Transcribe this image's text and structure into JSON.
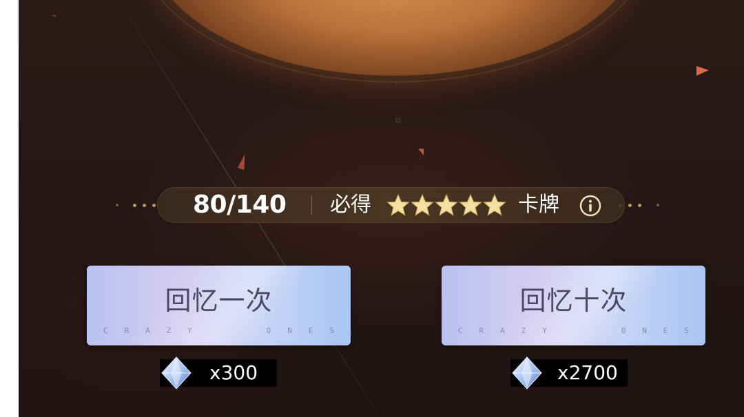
{
  "pity": {
    "count": "80/140",
    "guarantee_label": "必得",
    "star_rating": 5,
    "card_label": "卡牌"
  },
  "buttons": {
    "single": {
      "label": "回忆一次",
      "subtitle": [
        "C",
        "R",
        "A",
        "Z",
        "Y",
        "",
        "O",
        "N",
        "E",
        "S"
      ]
    },
    "ten": {
      "label": "回忆十次",
      "subtitle": [
        "C",
        "R",
        "A",
        "Z",
        "Y",
        "",
        "O",
        "N",
        "E",
        "S"
      ]
    }
  },
  "costs": {
    "single": "x300",
    "ten": "x2700"
  },
  "icons": {
    "star": "star-icon",
    "info": "info-icon",
    "currency": "crystal-gem-icon"
  },
  "colors": {
    "star_gold": "#f3dfa0",
    "button_text": "#4b4a66",
    "bar_bg": "#4a3824"
  }
}
